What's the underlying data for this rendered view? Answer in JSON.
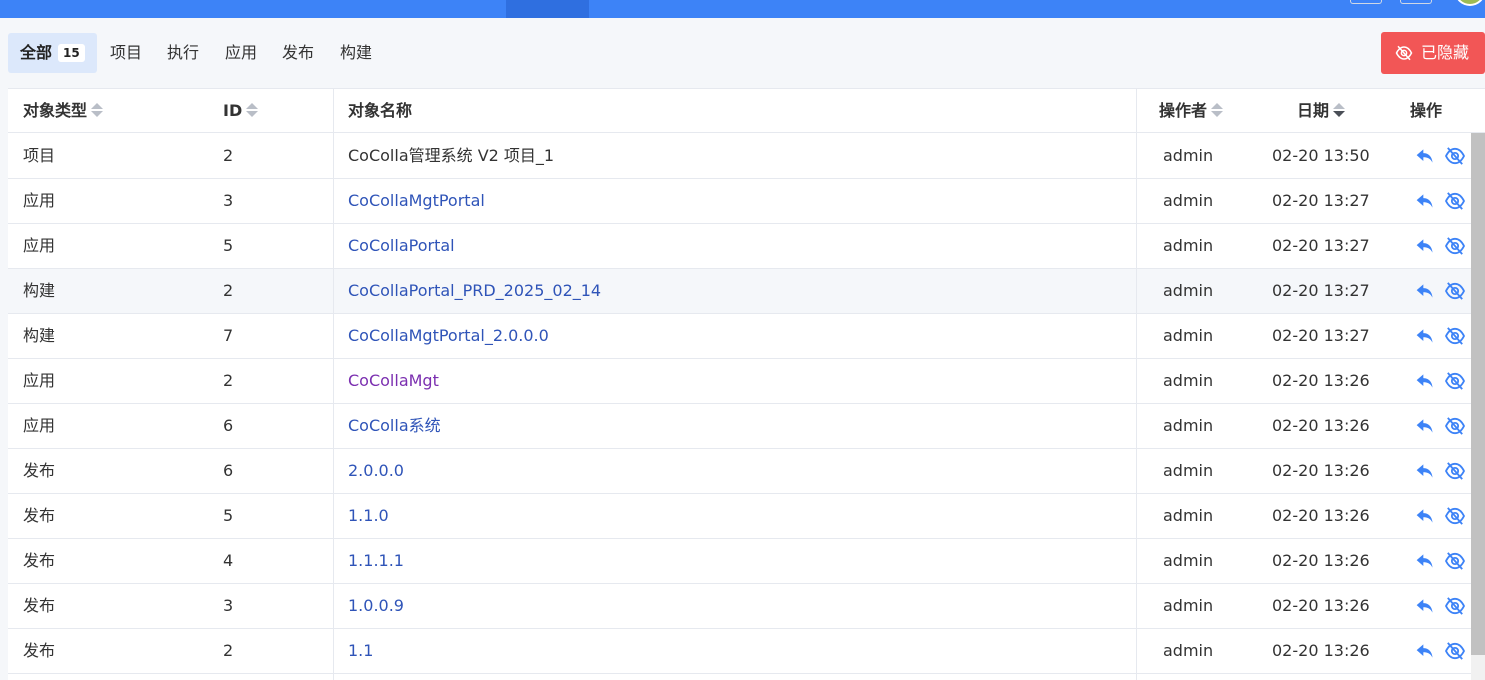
{
  "filter_tabs": [
    {
      "label": "全部",
      "count": "15"
    },
    {
      "label": "项目"
    },
    {
      "label": "执行"
    },
    {
      "label": "应用"
    },
    {
      "label": "发布"
    },
    {
      "label": "构建"
    }
  ],
  "hidden_button_label": "已隐藏",
  "columns": {
    "type": "对象类型",
    "id": "ID",
    "name": "对象名称",
    "operator": "操作者",
    "date": "日期",
    "actions": "操作"
  },
  "rows": [
    {
      "type": "项目",
      "id": "2",
      "name": "CoColla管理系统 V2 项目_1",
      "name_style": "plain",
      "operator": "admin",
      "date": "02-20 13:50"
    },
    {
      "type": "应用",
      "id": "3",
      "name": "CoCollaMgtPortal",
      "name_style": "link",
      "operator": "admin",
      "date": "02-20 13:27"
    },
    {
      "type": "应用",
      "id": "5",
      "name": "CoCollaPortal",
      "name_style": "link",
      "operator": "admin",
      "date": "02-20 13:27"
    },
    {
      "type": "构建",
      "id": "2",
      "name": "CoCollaPortal_PRD_2025_02_14",
      "name_style": "link",
      "operator": "admin",
      "date": "02-20 13:27",
      "hover": true
    },
    {
      "type": "构建",
      "id": "7",
      "name": "CoCollaMgtPortal_2.0.0.0",
      "name_style": "link",
      "operator": "admin",
      "date": "02-20 13:27"
    },
    {
      "type": "应用",
      "id": "2",
      "name": "CoCollaMgt",
      "name_style": "visited",
      "operator": "admin",
      "date": "02-20 13:26"
    },
    {
      "type": "应用",
      "id": "6",
      "name": "CoColla系统",
      "name_style": "link",
      "operator": "admin",
      "date": "02-20 13:26"
    },
    {
      "type": "发布",
      "id": "6",
      "name": "2.0.0.0",
      "name_style": "link",
      "operator": "admin",
      "date": "02-20 13:26"
    },
    {
      "type": "发布",
      "id": "5",
      "name": "1.1.0",
      "name_style": "link",
      "operator": "admin",
      "date": "02-20 13:26"
    },
    {
      "type": "发布",
      "id": "4",
      "name": "1.1.1.1",
      "name_style": "link",
      "operator": "admin",
      "date": "02-20 13:26"
    },
    {
      "type": "发布",
      "id": "3",
      "name": "1.0.0.9",
      "name_style": "link",
      "operator": "admin",
      "date": "02-20 13:26"
    },
    {
      "type": "发布",
      "id": "2",
      "name": "1.1",
      "name_style": "link",
      "operator": "admin",
      "date": "02-20 13:26"
    }
  ],
  "colors": {
    "topbar": "#3d83f7",
    "accent_blue": "#3d83f7",
    "link": "#2f54b8",
    "visited_link": "#7b2fb0",
    "danger": "#f25656"
  },
  "icons": {
    "restore": "reply-arrow-icon",
    "unhide": "eye-off-icon"
  }
}
